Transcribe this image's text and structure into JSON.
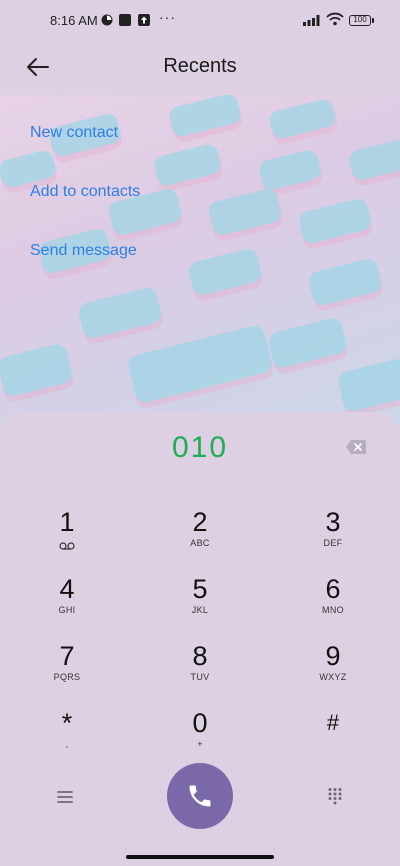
{
  "status_bar": {
    "time": "8:16 AM",
    "dots": "···",
    "battery": "100"
  },
  "header": {
    "title": "Recents",
    "back_icon": "arrow-left-icon"
  },
  "actions": [
    {
      "label": "New contact"
    },
    {
      "label": "Add to contacts"
    },
    {
      "label": "Send message"
    }
  ],
  "dialer": {
    "number": "010",
    "number_color": "#1fae55",
    "keys": [
      {
        "digit": "1",
        "letters": "",
        "icon": "voicemail-icon"
      },
      {
        "digit": "2",
        "letters": "ABC"
      },
      {
        "digit": "3",
        "letters": "DEF"
      },
      {
        "digit": "4",
        "letters": "GHI"
      },
      {
        "digit": "5",
        "letters": "JKL"
      },
      {
        "digit": "6",
        "letters": "MNO"
      },
      {
        "digit": "7",
        "letters": "PQRS"
      },
      {
        "digit": "8",
        "letters": "TUV"
      },
      {
        "digit": "9",
        "letters": "WXYZ"
      },
      {
        "digit": "*",
        "letters": ","
      },
      {
        "digit": "0",
        "letters": "+"
      },
      {
        "digit": "#",
        "letters": ""
      }
    ],
    "call_color": "#7a68a9"
  }
}
